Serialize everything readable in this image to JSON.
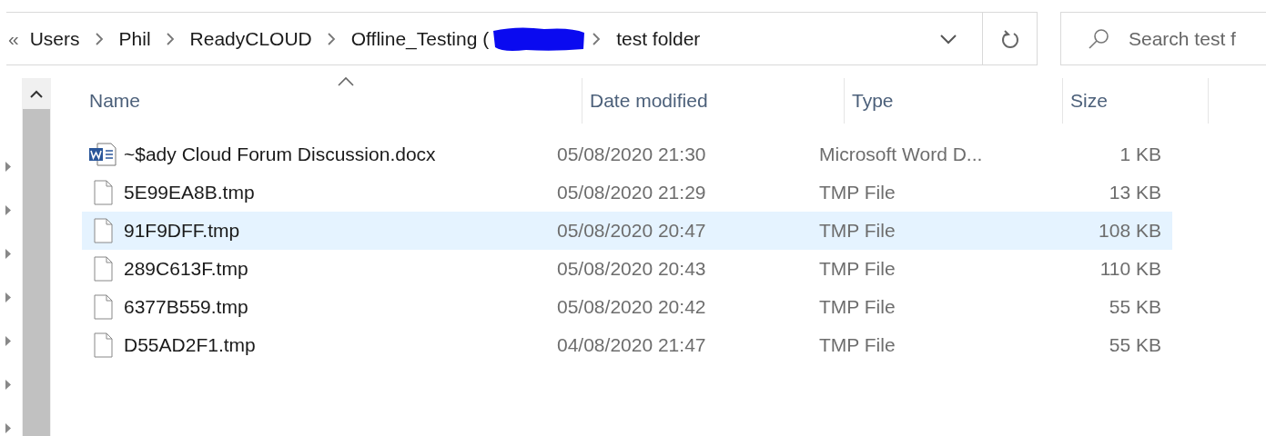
{
  "breadcrumb": {
    "overflow": "«",
    "items": [
      {
        "label": "Users",
        "redacted": false
      },
      {
        "label": "Phil",
        "redacted": false
      },
      {
        "label": "ReadyCLOUD",
        "redacted": false
      },
      {
        "label": "Offline_Testing (",
        "redacted": true
      },
      {
        "label": "test folder",
        "redacted": false
      }
    ]
  },
  "search": {
    "placeholder": "Search test f"
  },
  "table": {
    "columns": [
      "Name",
      "Date modified",
      "Type",
      "Size"
    ],
    "rows": [
      {
        "kind": "word",
        "name": "~$ady Cloud Forum Discussion.docx",
        "date": "05/08/2020 21:30",
        "type": "Microsoft Word D...",
        "size": "1 KB",
        "selected": false
      },
      {
        "kind": "file",
        "name": "5E99EA8B.tmp",
        "date": "05/08/2020 21:29",
        "type": "TMP File",
        "size": "13 KB",
        "selected": false
      },
      {
        "kind": "file",
        "name": "91F9DFF.tmp",
        "date": "05/08/2020 20:47",
        "type": "TMP File",
        "size": "108 KB",
        "selected": true
      },
      {
        "kind": "file",
        "name": "289C613F.tmp",
        "date": "05/08/2020 20:43",
        "type": "TMP File",
        "size": "110 KB",
        "selected": false
      },
      {
        "kind": "file",
        "name": "6377B559.tmp",
        "date": "05/08/2020 20:42",
        "type": "TMP File",
        "size": "55 KB",
        "selected": false
      },
      {
        "kind": "file",
        "name": "D55AD2F1.tmp",
        "date": "04/08/2020 21:47",
        "type": "TMP File",
        "size": "55 KB",
        "selected": false
      }
    ]
  }
}
